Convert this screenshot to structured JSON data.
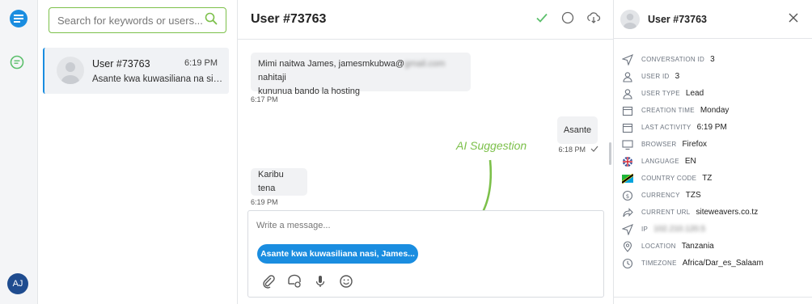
{
  "rail": {
    "avatar_initials": "AJ"
  },
  "list": {
    "search_placeholder": "Search for keywords or users...",
    "conversations": [
      {
        "name": "User #73763",
        "time": "6:19 PM",
        "preview": "Asante kwa kuwasiliana na sisi, James"
      }
    ]
  },
  "chat": {
    "title": "User #73763",
    "messages": [
      {
        "text_line1_a": "Mimi naitwa James, jamesmkubwa@",
        "text_line1_blur": "gmail.com",
        "text_line1_b": " nahitaji",
        "text_line2": "kununua bando la hosting",
        "time": "6:17 PM"
      },
      {
        "text": "Asante",
        "time": "6:18 PM"
      },
      {
        "text": "Karibu tena",
        "time": "6:19 PM"
      }
    ],
    "ai_label": "AI Suggestion",
    "composer_placeholder": "Write a message...",
    "suggestion": "Asante kwa kuwasiliana nasi, James..."
  },
  "details": {
    "name": "User #73763",
    "rows": [
      {
        "icon": "send-icon",
        "label": "Conversation ID",
        "value": "3"
      },
      {
        "icon": "user-icon",
        "label": "User ID",
        "value": "3"
      },
      {
        "icon": "user-icon",
        "label": "User type",
        "value": "Lead"
      },
      {
        "icon": "calendar-icon",
        "label": "Creation time",
        "value": "Monday"
      },
      {
        "icon": "calendar-icon",
        "label": "Last activity",
        "value": "6:19 PM"
      },
      {
        "icon": "monitor-icon",
        "label": "Browser",
        "value": "Firefox"
      },
      {
        "icon": "flag-uk-icon",
        "label": "Language",
        "value": "EN"
      },
      {
        "icon": "flag-tz-icon",
        "label": "Country code",
        "value": "TZ"
      },
      {
        "icon": "currency-icon",
        "label": "Currency",
        "value": "TZS"
      },
      {
        "icon": "share-icon",
        "label": "Current URL",
        "value": "siteweavers.co.tz"
      },
      {
        "icon": "send-icon",
        "label": "IP",
        "value": "102.210.120.5"
      },
      {
        "icon": "location-icon",
        "label": "Location",
        "value": "Tanzania"
      },
      {
        "icon": "clock-icon",
        "label": "Timezone",
        "value": "Africa/Dar_es_Salaam"
      }
    ]
  }
}
